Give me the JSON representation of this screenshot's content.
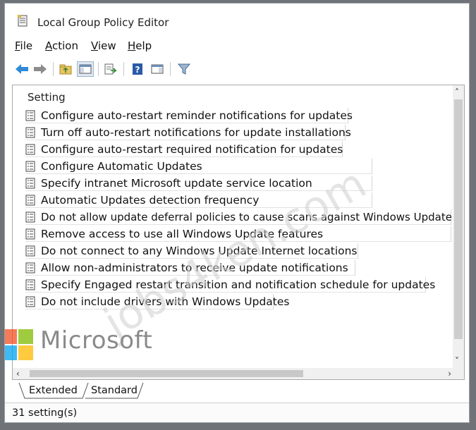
{
  "window": {
    "title": "Local Group Policy Editor"
  },
  "menu": {
    "items": [
      {
        "accel": "F",
        "rest": "ile"
      },
      {
        "accel": "A",
        "rest": "ction"
      },
      {
        "accel": "V",
        "rest": "iew"
      },
      {
        "accel": "H",
        "rest": "elp"
      }
    ]
  },
  "toolbar": {
    "icons": [
      "back-arrow-icon",
      "forward-arrow-icon",
      "up-folder-icon",
      "show-hide-tree-icon",
      "export-list-icon",
      "help-icon",
      "properties-pane-icon",
      "filter-icon"
    ]
  },
  "list": {
    "column_header": "Setting",
    "rows": [
      "Configure auto-restart reminder notifications for updates",
      "Turn off auto-restart notifications for update installations",
      "Configure auto-restart required notification for updates",
      "Configure Automatic Updates",
      "Specify intranet Microsoft update service location",
      "Automatic Updates detection frequency",
      "Do not allow update deferral policies to cause scans against Windows Update",
      "Remove access to use all Windows Update features",
      "Do not connect to any Windows Update Internet locations",
      "Allow non-administrators to receive update notifications",
      "Specify Engaged restart transition and notification schedule for updates",
      "Do not include drivers with Windows Updates"
    ]
  },
  "tabs": [
    "Extended",
    "Standard"
  ],
  "status": {
    "text": "31 setting(s)"
  },
  "watermark": {
    "brand": "Microsoft",
    "site": "jobs4ken.com"
  },
  "colors": {
    "ms_red": "#f25022",
    "ms_green": "#7fba00",
    "ms_blue": "#00a4ef",
    "ms_yellow": "#ffb900"
  }
}
